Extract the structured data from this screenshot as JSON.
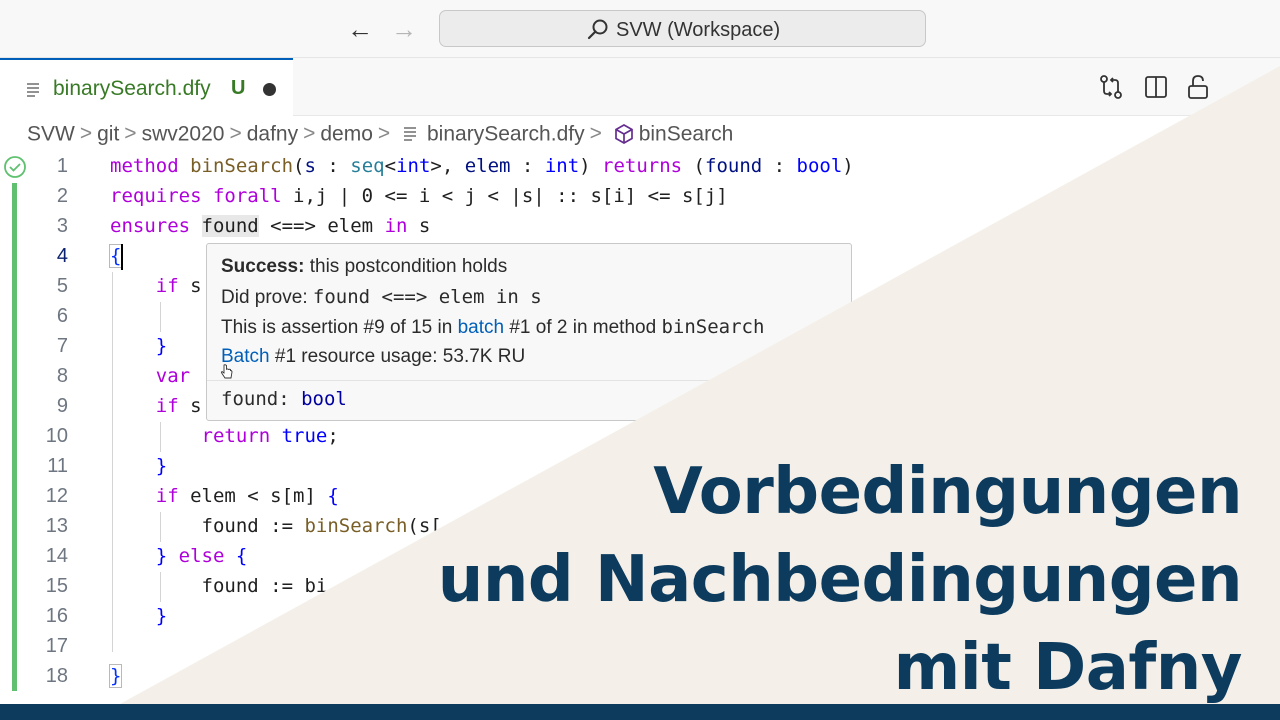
{
  "titlebar": {
    "search_text": "SVW (Workspace)",
    "back_glyph": "←",
    "forward_glyph": "→"
  },
  "tab": {
    "label": "binarySearch.dfy",
    "status": "U"
  },
  "breadcrumb": {
    "items": [
      "SVW",
      "git",
      "swv2020",
      "dafny",
      "demo",
      "binarySearch.dfy",
      "binSearch"
    ],
    "separator": ">"
  },
  "editor": {
    "line_numbers": [
      "1",
      "2",
      "3",
      "4",
      "5",
      "6",
      "7",
      "8",
      "9",
      "10",
      "11",
      "12",
      "13",
      "14",
      "15",
      "16",
      "17",
      "18"
    ],
    "active_line": "4"
  },
  "hover": {
    "title_bold": "Success:",
    "title_rest": " this postcondition holds",
    "proof_label": "Did prove: ",
    "proof_code": "found <==> elem in s",
    "assertion_pre": "This is assertion #9 of 15 in ",
    "assertion_link": "batch",
    "assertion_post": " #1 of 2 in method ",
    "assertion_code": "binSearch",
    "batch_link": "Batch",
    "batch_rest": " #1 resource usage: 53.7K RU",
    "sig_name": "found: ",
    "sig_type": "bool"
  },
  "headline": {
    "line1": "Vorbedingungen",
    "line2": "und Nachbedingungen",
    "line3": "mit Dafny"
  },
  "colors": {
    "accent": "#005fb8",
    "headline": "#0c3b5e",
    "overlay": "#f4f0e9",
    "gutter_green": "#5fc16f",
    "tab_green": "#387a26"
  }
}
